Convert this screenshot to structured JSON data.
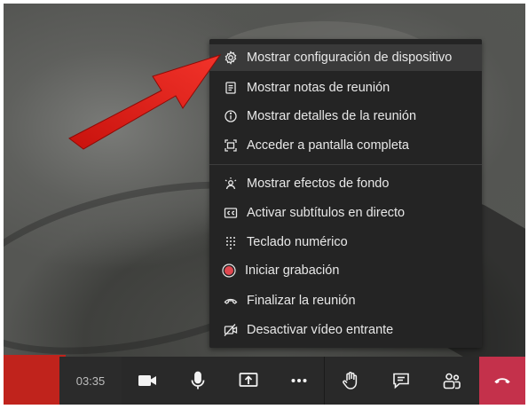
{
  "menu": {
    "items": [
      {
        "label": "Mostrar configuración de dispositivo",
        "icon": "gear-icon"
      },
      {
        "label": "Mostrar notas de reunión",
        "icon": "notes-icon"
      },
      {
        "label": "Mostrar detalles de la reunión",
        "icon": "info-icon"
      },
      {
        "label": "Acceder a pantalla completa",
        "icon": "fullscreen-icon"
      },
      {
        "label": "Mostrar efectos de fondo",
        "icon": "background-effects-icon"
      },
      {
        "label": "Activar subtítulos en directo",
        "icon": "captions-icon"
      },
      {
        "label": "Teclado numérico",
        "icon": "dialpad-icon"
      },
      {
        "label": "Iniciar grabación",
        "icon": "record-icon"
      },
      {
        "label": "Finalizar la reunión",
        "icon": "end-call-icon"
      },
      {
        "label": "Desactivar vídeo entrante",
        "icon": "video-off-icon"
      }
    ]
  },
  "toolbar": {
    "timer": "03:35",
    "buttons": [
      "camera-icon",
      "microphone-icon",
      "share-screen-icon",
      "more-options-icon",
      "raise-hand-icon",
      "chat-icon",
      "participants-icon"
    ],
    "hangup": "hang-up-icon"
  },
  "colors": {
    "menu_bg": "#242424",
    "highlight": "#3a3a3a",
    "hangup": "#c4314b",
    "record": "#e0474f",
    "arrow": "#e2221b"
  }
}
